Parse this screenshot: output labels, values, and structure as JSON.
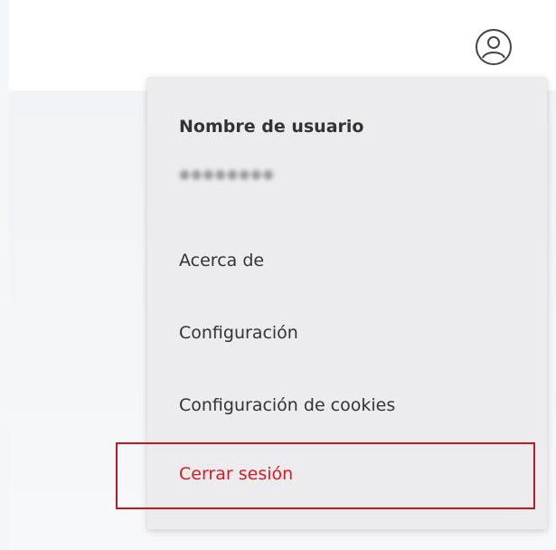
{
  "header": {
    "avatar_icon": "user-circle-icon"
  },
  "user_menu": {
    "username_label": "Nombre de usuario",
    "username_value": "●●●●●●●●",
    "items": [
      {
        "label": "Acerca de"
      },
      {
        "label": "Configuración"
      },
      {
        "label": "Configuración de cookies"
      },
      {
        "label": "Cerrar sesión"
      }
    ]
  },
  "colors": {
    "logout_text": "#d9191f",
    "highlight_border": "#c41820",
    "menu_bg": "#ececef",
    "icon_stroke": "#444444"
  }
}
